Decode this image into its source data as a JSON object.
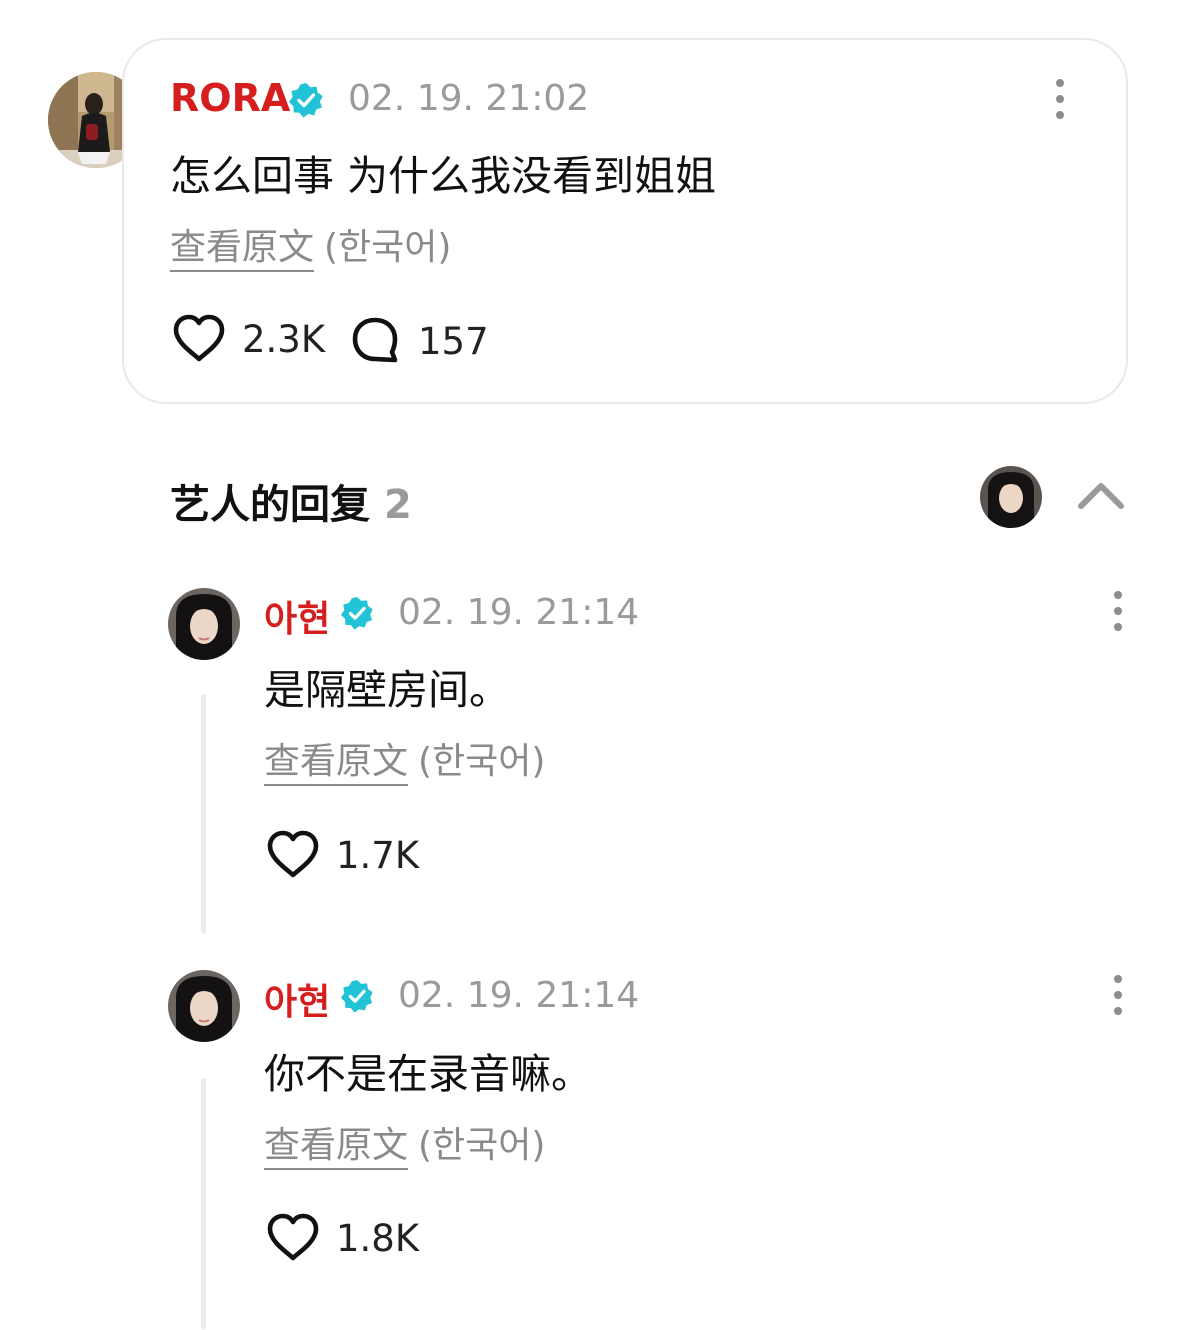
{
  "colors": {
    "username": "#d61e1e",
    "verified": "#22c3d6",
    "muted": "#9a9a9a",
    "text": "#111111"
  },
  "post": {
    "username": "RORA",
    "timestamp": "02. 19. 21:02",
    "text": "怎么回事 为什么我没看到姐姐",
    "translate_link": "查看原文",
    "translate_lang": "(한국어)",
    "likes": "2.3K",
    "comments": "157",
    "icons": [
      "heart-icon",
      "comment-bubble-icon",
      "more-vertical-icon",
      "verified-badge-icon"
    ]
  },
  "artist_replies": {
    "title": "艺人的回复",
    "count": "2",
    "collapse_icon": "chevron-up-icon"
  },
  "replies": [
    {
      "username": "아현",
      "timestamp": "02. 19. 21:14",
      "text": "是隔壁房间。",
      "translate_link": "查看原文",
      "translate_lang": "(한국어)",
      "likes": "1.7K"
    },
    {
      "username": "아현",
      "timestamp": "02. 19. 21:14",
      "text": "你不是在录音嘛。",
      "translate_link": "查看原文",
      "translate_lang": "(한국어)",
      "likes": "1.8K"
    }
  ]
}
